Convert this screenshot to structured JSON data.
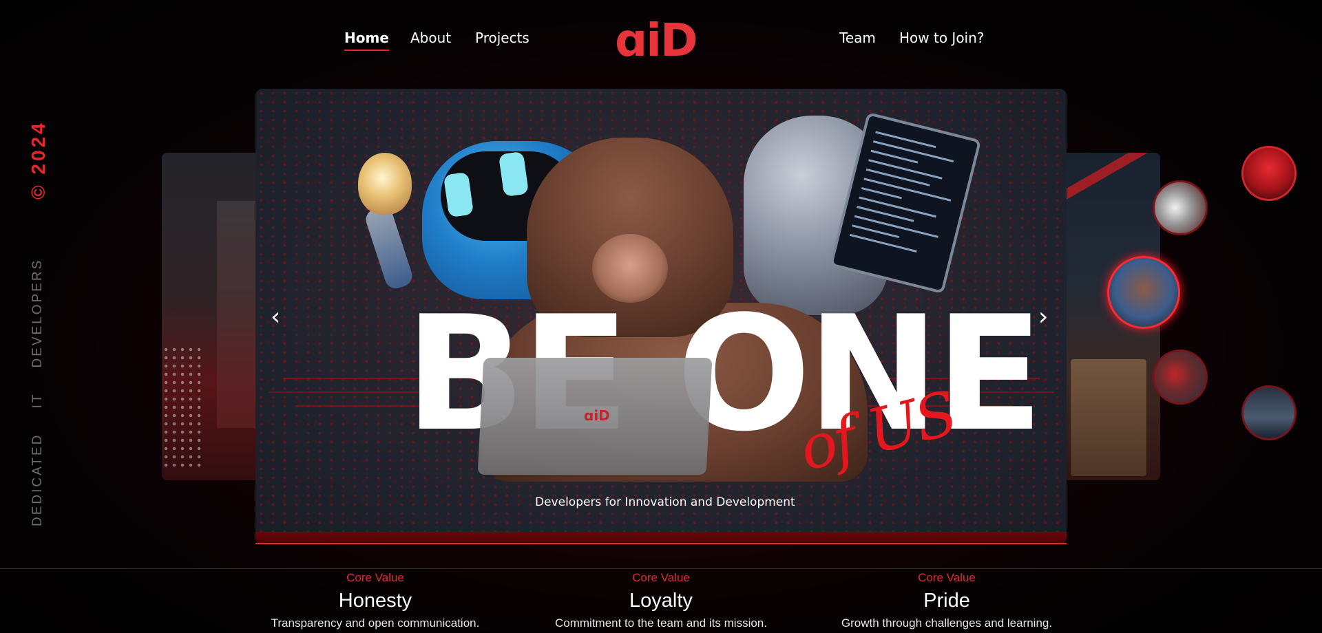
{
  "nav": {
    "left_links": [
      "Home",
      "About",
      "Projects"
    ],
    "logo": "ɑiD",
    "right_links": [
      "Team",
      "How to Join?"
    ]
  },
  "side": {
    "year": "© 2024",
    "tagline": "DEDICATED IT DEVELOPERS"
  },
  "hero": {
    "headline": "BE ONE",
    "script": "of US",
    "laptop_logo": "ɑiD",
    "tagline": "Developers for Innovation and Development",
    "prev_label": "‹",
    "next_label": "›"
  },
  "core_values": [
    {
      "kicker": "Core Value",
      "title": "Honesty",
      "desc": "Transparency and open communication."
    },
    {
      "kicker": "Core Value",
      "title": "Loyalty",
      "desc": "Commitment to the team and its mission."
    },
    {
      "kicker": "Core Value",
      "title": "Pride",
      "desc": "Growth through challenges and learning."
    }
  ],
  "colors": {
    "accent": "#e0282e",
    "background": "#050203"
  }
}
